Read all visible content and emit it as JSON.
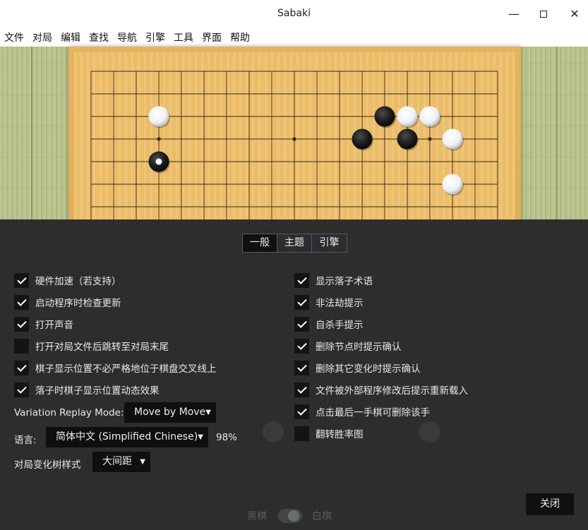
{
  "window": {
    "title": "Sabaki"
  },
  "menu": [
    "文件",
    "对局",
    "编辑",
    "查找",
    "导航",
    "引擎",
    "工具",
    "界面",
    "帮助"
  ],
  "tabs": [
    {
      "label": "一般",
      "active": true
    },
    {
      "label": "主题",
      "active": false
    },
    {
      "label": "引擎",
      "active": false
    }
  ],
  "left_options": [
    {
      "label": "硬件加速（若支持）",
      "checked": true
    },
    {
      "label": "启动程序时检查更新",
      "checked": true
    },
    {
      "label": "打开声音",
      "checked": true
    },
    {
      "label": "打开对局文件后跳转至对局末尾",
      "checked": false
    },
    {
      "label": "棋子显示位置不必严格地位于棋盘交叉线上",
      "checked": true
    },
    {
      "label": "落子时棋子显示位置动态效果",
      "checked": true
    }
  ],
  "right_options": [
    {
      "label": "显示落子术语",
      "checked": true
    },
    {
      "label": "非法劫提示",
      "checked": true
    },
    {
      "label": "自杀手提示",
      "checked": true
    },
    {
      "label": "删除节点时提示确认",
      "checked": true
    },
    {
      "label": "删除其它变化时提示确认",
      "checked": true
    },
    {
      "label": "文件被外部程序修改后提示重新载入",
      "checked": true
    },
    {
      "label": "点击最后一手棋可删除该手",
      "checked": true
    },
    {
      "label": "翻转胜率图",
      "checked": false
    }
  ],
  "variation_replay": {
    "label": "Variation Replay Mode:",
    "value": "Move by Move"
  },
  "language": {
    "label": "语言:",
    "value": "简体中文 (Simplified Chinese)",
    "percent": "98%"
  },
  "tree_style": {
    "label": "对局变化树样式",
    "value": "大间距"
  },
  "close_label": "关闭",
  "bottom_hints": {
    "left": "黑棋",
    "right": "白棋"
  },
  "board": {
    "size": 19,
    "stones": [
      {
        "color": "white",
        "col": 3,
        "row": 2
      },
      {
        "color": "black",
        "col": 3,
        "row": 4,
        "last_move": true
      },
      {
        "color": "black",
        "col": 13,
        "row": 2
      },
      {
        "color": "white",
        "col": 14,
        "row": 2
      },
      {
        "color": "white",
        "col": 15,
        "row": 2
      },
      {
        "color": "black",
        "col": 12,
        "row": 3
      },
      {
        "color": "black",
        "col": 14,
        "row": 3
      },
      {
        "color": "white",
        "col": 16,
        "row": 3
      },
      {
        "color": "white",
        "col": 16,
        "row": 5
      }
    ],
    "star_points": [
      [
        3,
        3
      ],
      [
        9,
        3
      ],
      [
        15,
        3
      ]
    ]
  },
  "colors": {
    "panel": "#26282a",
    "board": "#efc26f",
    "mat": "#b9c48c"
  }
}
